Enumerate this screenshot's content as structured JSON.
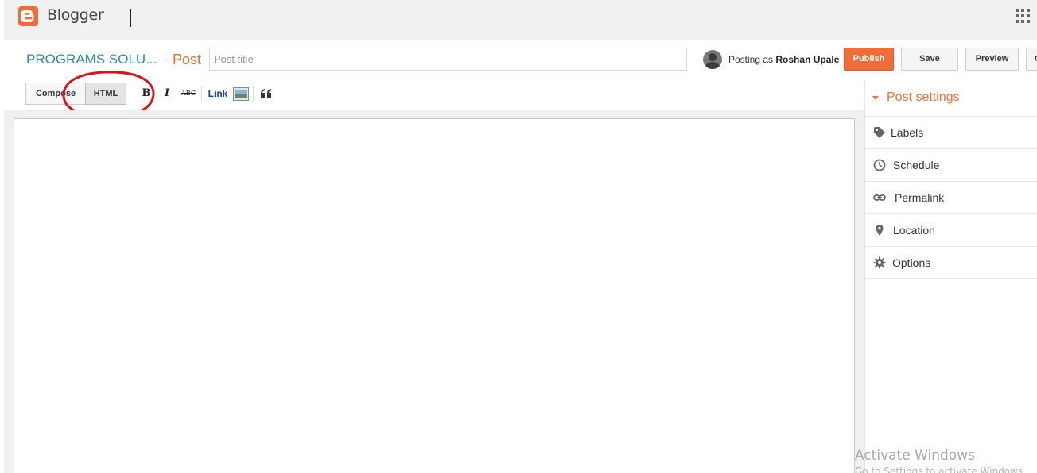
{
  "app": {
    "name": "Blogger"
  },
  "header": {
    "blog_name": "PROGRAMS SOLU...",
    "separator": "·",
    "section": "Post",
    "title_placeholder": "Post title",
    "posting_as_prefix": "Posting as",
    "user_name": "Roshan Upale"
  },
  "actions": {
    "publish": "Publish",
    "save": "Save",
    "preview": "Preview",
    "close": "C"
  },
  "toolbar": {
    "compose": "Compose",
    "html": "HTML",
    "bold": "B",
    "italic": "I",
    "strike": "ABC",
    "link": "Link",
    "icons": [
      "bold-icon",
      "italic-icon",
      "strikethrough-icon",
      "image-icon",
      "quote-icon"
    ],
    "active_mode": "HTML"
  },
  "sidebar": {
    "title": "Post settings",
    "items": [
      {
        "label": "Labels",
        "icon": "tag-icon"
      },
      {
        "label": "Schedule",
        "icon": "clock-icon"
      },
      {
        "label": "Permalink",
        "icon": "link-icon"
      },
      {
        "label": "Location",
        "icon": "map-pin-icon"
      },
      {
        "label": "Options",
        "icon": "gear-icon"
      }
    ]
  },
  "watermark": {
    "line1": "Activate Windows",
    "line2": "Go to Settings to activate Windows."
  },
  "colors": {
    "accent": "#f26c37",
    "blog_name": "#2a8ea0",
    "annotation_circle": "#d8141b"
  }
}
